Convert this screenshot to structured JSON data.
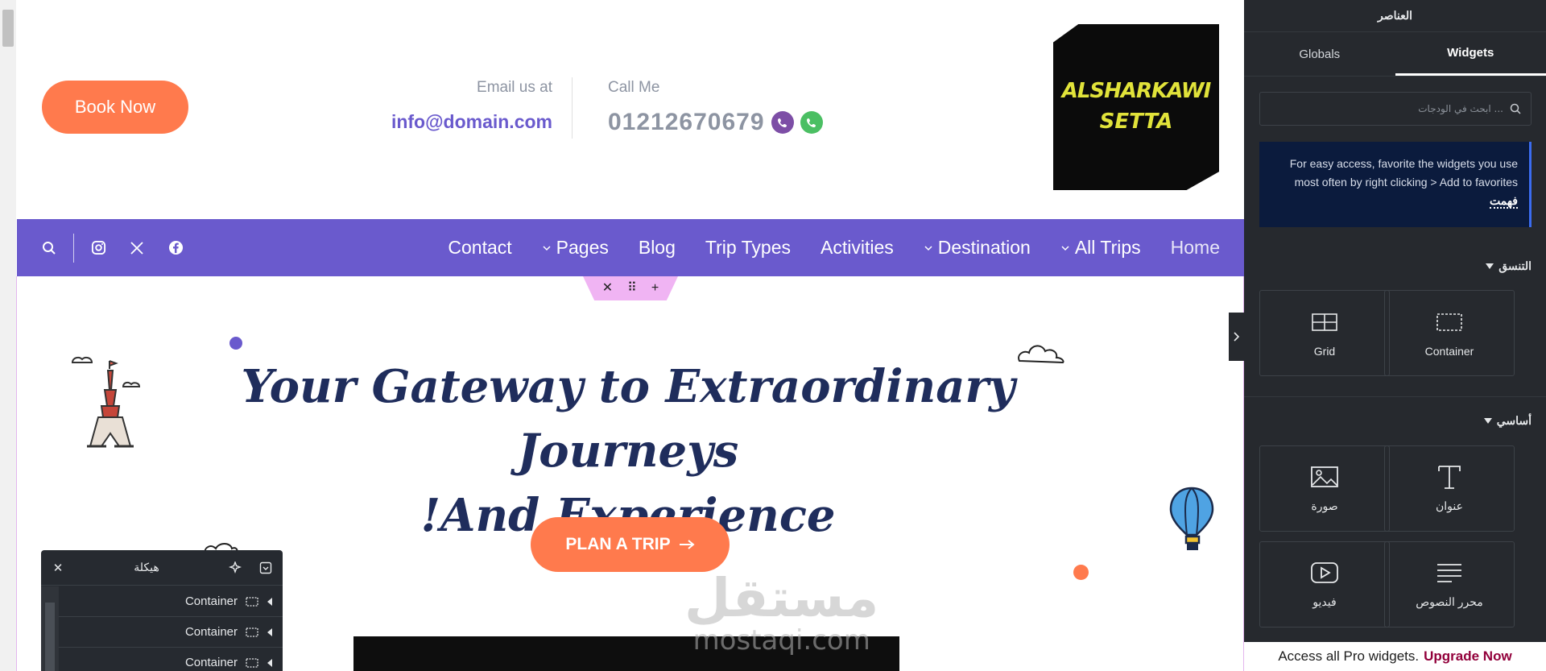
{
  "header": {
    "book_button": "Book Now",
    "email_label": "Email us at",
    "email_value": "info@domain.com",
    "call_label": "Call Me",
    "phone_value": "01212670679",
    "logo_line1": "ALSHARKAWI",
    "logo_line2": "SETTA"
  },
  "nav": {
    "items": [
      {
        "label": "Contact",
        "dropdown": false
      },
      {
        "label": "Pages",
        "dropdown": true
      },
      {
        "label": "Blog",
        "dropdown": false
      },
      {
        "label": "Trip Types",
        "dropdown": false
      },
      {
        "label": "Activities",
        "dropdown": false
      },
      {
        "label": "Destination",
        "dropdown": true
      },
      {
        "label": "All Trips",
        "dropdown": true
      },
      {
        "label": "Home",
        "dropdown": false
      }
    ],
    "icons": [
      "search-icon",
      "instagram-icon",
      "x-twitter-icon",
      "facebook-icon"
    ]
  },
  "section_handle": {
    "icons": [
      "close-icon",
      "drag-handle-icon",
      "add-icon"
    ]
  },
  "hero": {
    "title_line1": "Your Gateway to Extraordinary Journeys",
    "title_line2": "!And Experience",
    "plan_button": "PLAN A TRIP"
  },
  "watermark": {
    "arabic": "مستقل",
    "latin": "mostaqi.com"
  },
  "navigator": {
    "title": "هيكلة",
    "rows": [
      "Container",
      "Container",
      "Container"
    ]
  },
  "panel": {
    "title": "العناصر",
    "tabs": [
      {
        "label": "Globals",
        "active": false
      },
      {
        "label": "Widgets",
        "active": true
      }
    ],
    "search_placeholder": "ابحث في الودجات ...",
    "tip_text": "For easy access, favorite the widgets you use most often by right clicking > Add to favorites",
    "tip_action": "فهمت",
    "categories": [
      {
        "title": "التنسق",
        "widgets": [
          {
            "label": "Container",
            "icon": "container-icon"
          },
          {
            "label": "Grid",
            "icon": "grid-icon"
          }
        ]
      },
      {
        "title": "أساسي",
        "widgets": [
          {
            "label": "عنوان",
            "icon": "heading-icon"
          },
          {
            "label": "صورة",
            "icon": "image-icon"
          },
          {
            "label": "محرر النصوص",
            "icon": "text-editor-icon"
          },
          {
            "label": "فيديو",
            "icon": "video-icon"
          }
        ]
      }
    ],
    "upgrade_text": "Access all Pro widgets.",
    "upgrade_link": "Upgrade Now"
  },
  "colors": {
    "accent_orange": "#ff7a4d",
    "brand_purple": "#6a5acd",
    "title_navy": "#1f2d5c",
    "panel_bg": "#26292e",
    "tip_bg": "#0b1b3d"
  }
}
